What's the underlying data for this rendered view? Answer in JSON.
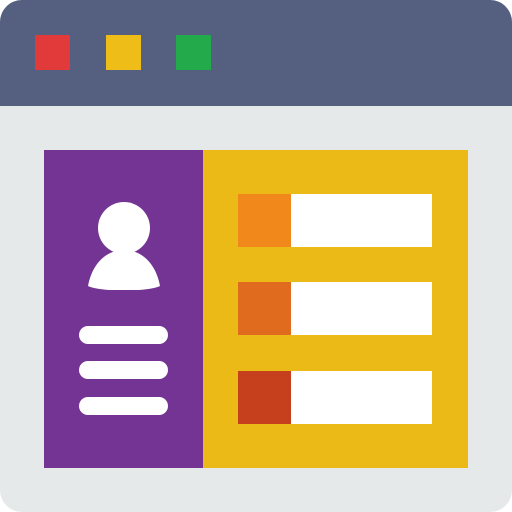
{
  "window": {
    "controls": [
      {
        "name": "close",
        "color": "#e23a3a"
      },
      {
        "name": "minimize",
        "color": "#efbd17"
      },
      {
        "name": "maximize",
        "color": "#22aa4b"
      }
    ],
    "titlebar_color": "#556080",
    "background_color": "#e5e9ea"
  },
  "profile": {
    "card_color": "#733494",
    "avatar_icon": "user-avatar-icon",
    "lines": 3
  },
  "details": {
    "panel_color": "#ebba16",
    "fields": [
      {
        "swatch_color": "#f0881c",
        "value": ""
      },
      {
        "swatch_color": "#e06b1f",
        "value": ""
      },
      {
        "swatch_color": "#c7401e",
        "value": ""
      }
    ]
  }
}
